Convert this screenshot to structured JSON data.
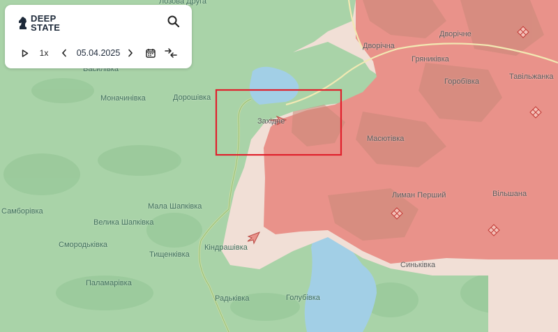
{
  "app": {
    "name_line1": "DEEP",
    "name_line2": "STATE"
  },
  "controls": {
    "speed": "1x",
    "date": "05.04.2025"
  },
  "icons": {
    "logo": "knight-chess-icon",
    "search": "search-icon",
    "play": "play-icon",
    "prev": "chevron-left-icon",
    "next": "chevron-right-icon",
    "calendar": "calendar-icon",
    "compare": "compare-arrows-icon"
  },
  "colors": {
    "free_territory": "#a9d3a8",
    "occupied": "#e9928a",
    "grey_zone": "#f1dfd6",
    "water": "#a2cfe6",
    "highlight_box": "#e0202c",
    "attack_arrow": "#d9534f"
  },
  "places": [
    {
      "id": "lozova-druha",
      "name": "Лозова Друга"
    },
    {
      "id": "vasylivka",
      "name": "Василівка"
    },
    {
      "id": "dvorichne",
      "name": "Дворічне"
    },
    {
      "id": "dvorichna",
      "name": "Дворічна"
    },
    {
      "id": "hrianykivka",
      "name": "Гряниківка"
    },
    {
      "id": "tavilzhanka",
      "name": "Тавільжанка"
    },
    {
      "id": "monachynivka",
      "name": "Моначинівка"
    },
    {
      "id": "doroshivka",
      "name": "Дорошівка"
    },
    {
      "id": "horobivka",
      "name": "Горобївка"
    },
    {
      "id": "zapadne",
      "name": "Західне"
    },
    {
      "id": "masiutivka",
      "name": "Масютівка"
    },
    {
      "id": "lyman-pershyi",
      "name": "Лиман Перший"
    },
    {
      "id": "vilshana",
      "name": "Вільшана"
    },
    {
      "id": "samborivka",
      "name": "Самборівка"
    },
    {
      "id": "mala-shapkivka",
      "name": "Мала Шапківка"
    },
    {
      "id": "velyka-shapkivka",
      "name": "Велика Шапківка"
    },
    {
      "id": "kindrashivka",
      "name": "Кіндрашівка"
    },
    {
      "id": "smorodkivka",
      "name": "Смородьківка"
    },
    {
      "id": "tyshchenkivka",
      "name": "Тищенківка"
    },
    {
      "id": "synkivka",
      "name": "Синьківка"
    },
    {
      "id": "palamarivka",
      "name": "Паламарівка"
    },
    {
      "id": "radkivka",
      "name": "Радьківка"
    },
    {
      "id": "holubivka",
      "name": "Голубівка"
    }
  ]
}
